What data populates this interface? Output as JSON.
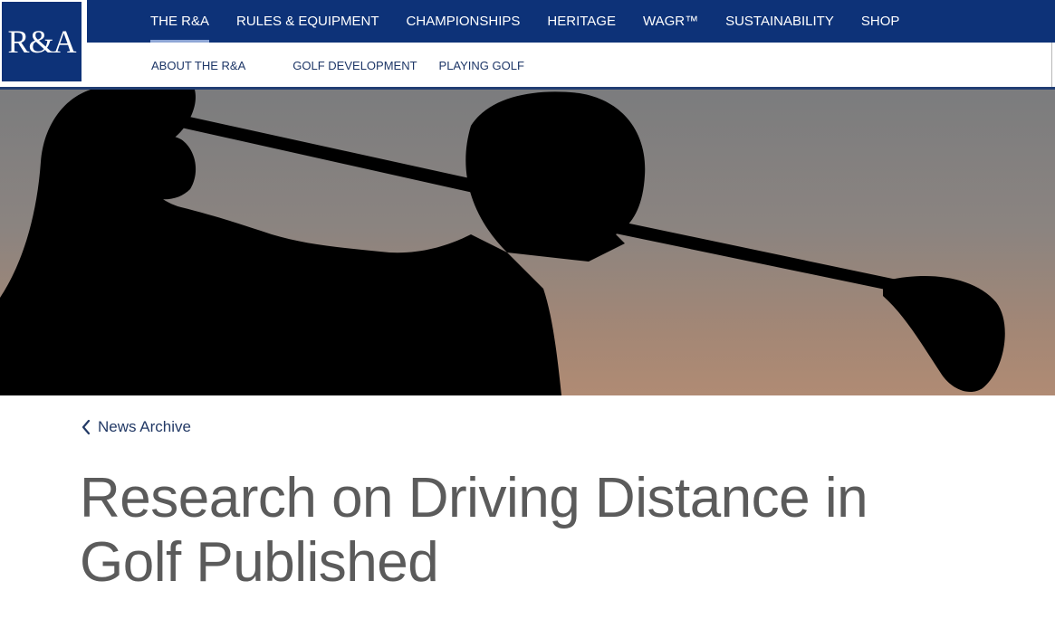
{
  "brand": {
    "logo_text": "R&A",
    "color": "#0d3278"
  },
  "top_nav": {
    "items": [
      {
        "label": "THE R&A",
        "active": true
      },
      {
        "label": "RULES & EQUIPMENT"
      },
      {
        "label": "CHAMPIONSHIPS"
      },
      {
        "label": "HERITAGE"
      },
      {
        "label": "WAGR™"
      },
      {
        "label": "SUSTAINABILITY"
      },
      {
        "label": "SHOP"
      }
    ]
  },
  "sub_nav": {
    "items": [
      {
        "label": "ABOUT THE R&A"
      },
      {
        "label": "GOLF DEVELOPMENT"
      },
      {
        "label": "PLAYING GOLF"
      }
    ]
  },
  "hero": {
    "icon": "golfer-silhouette"
  },
  "article": {
    "back_link": "News Archive",
    "back_icon": "chevron-left-icon",
    "title": "Research on Driving Distance in Golf Published"
  }
}
